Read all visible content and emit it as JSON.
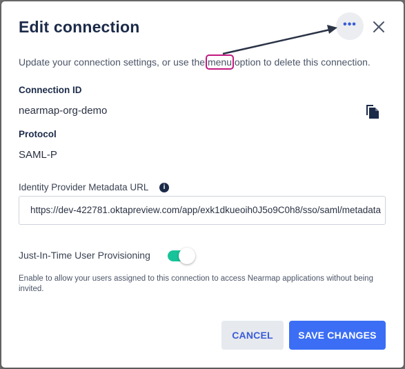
{
  "dialog": {
    "title": "Edit connection",
    "subtitle_before": "Update your connection settings, or use the ",
    "subtitle_highlight": "menu",
    "subtitle_after": " option to delete this connection.",
    "menu_icon": "more-horizontal-icon",
    "close_icon": "close-icon"
  },
  "connection_id": {
    "label": "Connection ID",
    "value": "nearmap-org-demo",
    "copy_icon": "copy-icon"
  },
  "protocol": {
    "label": "Protocol",
    "value": "SAML-P"
  },
  "metadata_url": {
    "label": "Identity Provider Metadata URL",
    "info_icon": "i",
    "value": "https://dev-422781.oktapreview.com/app/exk1dkueoih0J5o9C0h8/sso/saml/metadata"
  },
  "jit": {
    "label": "Just-In-Time User Provisioning",
    "enabled": true,
    "help": "Enable to allow your users assigned to this connection to access Nearmap applications without being invited."
  },
  "actions": {
    "cancel": "CANCEL",
    "save": "SAVE CHANGES"
  },
  "colors": {
    "accent": "#3b6ef5",
    "toggle_on": "#19c39a",
    "highlight": "#c2187f",
    "heading": "#1b2a48"
  }
}
